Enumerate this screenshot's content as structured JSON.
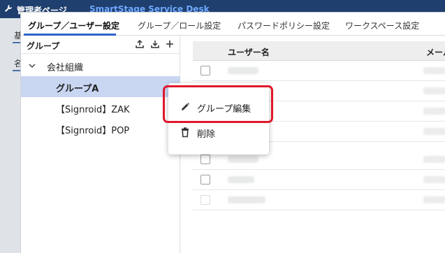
{
  "background": {
    "title": "管理者ペー",
    "title_suffix": "ジ",
    "app_name": "SmartStage Service Desk",
    "left_tab_1": "基",
    "left_tab_2": "名"
  },
  "tabs": [
    {
      "label": "グループ／ユーザー設定",
      "active": true
    },
    {
      "label": "グループ／ロール設定",
      "active": false
    },
    {
      "label": "パスワードポリシー設定",
      "active": false
    },
    {
      "label": "ワークスペース設定",
      "active": false
    }
  ],
  "group_panel": {
    "title": "グループ",
    "icons": [
      "upload-icon",
      "download-icon",
      "plus-icon"
    ],
    "tree": [
      {
        "label": "会社組織",
        "level": 0,
        "expanded": true,
        "selected": false
      },
      {
        "label": "グループA",
        "level": 1,
        "selected": true
      },
      {
        "label": "【Signroid】ZAK",
        "level": 1,
        "selected": false
      },
      {
        "label": "【Signroid】POP",
        "level": 1,
        "selected": false
      }
    ]
  },
  "user_table": {
    "columns": [
      "ユーザー名",
      "メール"
    ],
    "rows": [
      {
        "blurred": true
      },
      {
        "blurred": true
      },
      {
        "blurred": true
      },
      {
        "blurred": true
      },
      {
        "blurred": true
      },
      {
        "blurred": true
      },
      {
        "blurred": true
      }
    ]
  },
  "context_menu": {
    "items": [
      {
        "label": "グループ編集",
        "icon": "pencil-icon"
      },
      {
        "label": "削除",
        "icon": "trash-icon"
      }
    ],
    "highlighted_item": "グループ編集"
  },
  "colors": {
    "accent": "#2f63c9",
    "selected_row": "#c9d6f2",
    "highlight_frame": "#e0182a"
  }
}
